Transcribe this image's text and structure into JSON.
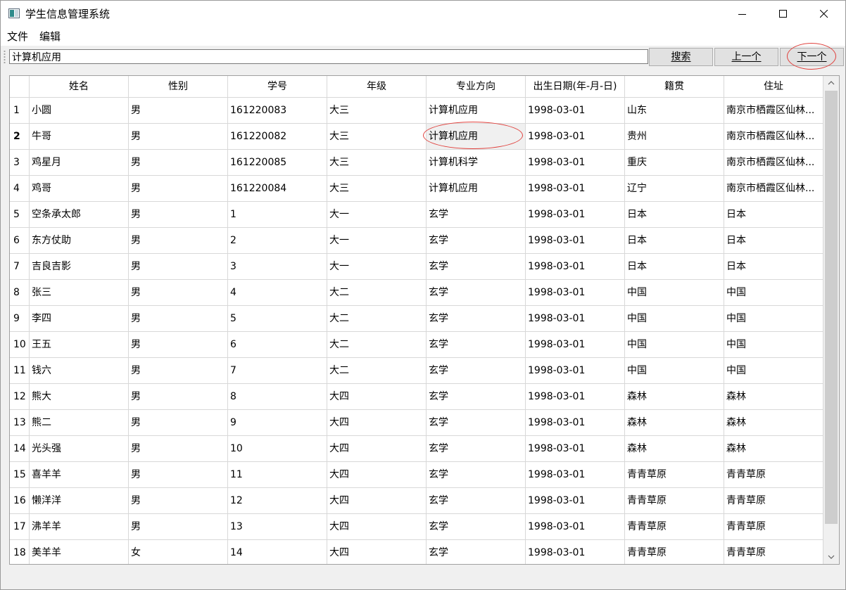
{
  "window": {
    "title": "学生信息管理系统"
  },
  "menu": {
    "file": "文件",
    "edit": "编辑"
  },
  "toolbar": {
    "search_value": "计算机应用",
    "search_label": "搜索",
    "prev_label": "上一个",
    "next_label": "下一个"
  },
  "table": {
    "headers": [
      "姓名",
      "性别",
      "学号",
      "年级",
      "专业方向",
      "出生日期(年-月-日)",
      "籍贯",
      "住址"
    ],
    "current_row": 2,
    "rows": [
      [
        "1",
        "小圆",
        "男",
        "161220083",
        "大三",
        "计算机应用",
        "1998-03-01",
        "山东",
        "南京市栖霞区仙林..."
      ],
      [
        "2",
        "牛哥",
        "男",
        "161220082",
        "大三",
        "计算机应用",
        "1998-03-01",
        "贵州",
        "南京市栖霞区仙林..."
      ],
      [
        "3",
        "鸡星月",
        "男",
        "161220085",
        "大三",
        "计算机科学",
        "1998-03-01",
        "重庆",
        "南京市栖霞区仙林..."
      ],
      [
        "4",
        "鸡哥",
        "男",
        "161220084",
        "大三",
        "计算机应用",
        "1998-03-01",
        "辽宁",
        "南京市栖霞区仙林..."
      ],
      [
        "5",
        "空条承太郎",
        "男",
        "1",
        "大一",
        "玄学",
        "1998-03-01",
        "日本",
        "日本"
      ],
      [
        "6",
        "东方仗助",
        "男",
        "2",
        "大一",
        "玄学",
        "1998-03-01",
        "日本",
        "日本"
      ],
      [
        "7",
        "吉良吉影",
        "男",
        "3",
        "大一",
        "玄学",
        "1998-03-01",
        "日本",
        "日本"
      ],
      [
        "8",
        "张三",
        "男",
        "4",
        "大二",
        "玄学",
        "1998-03-01",
        "中国",
        "中国"
      ],
      [
        "9",
        "李四",
        "男",
        "5",
        "大二",
        "玄学",
        "1998-03-01",
        "中国",
        "中国"
      ],
      [
        "10",
        "王五",
        "男",
        "6",
        "大二",
        "玄学",
        "1998-03-01",
        "中国",
        "中国"
      ],
      [
        "11",
        "钱六",
        "男",
        "7",
        "大二",
        "玄学",
        "1998-03-01",
        "中国",
        "中国"
      ],
      [
        "12",
        "熊大",
        "男",
        "8",
        "大四",
        "玄学",
        "1998-03-01",
        "森林",
        "森林"
      ],
      [
        "13",
        "熊二",
        "男",
        "9",
        "大四",
        "玄学",
        "1998-03-01",
        "森林",
        "森林"
      ],
      [
        "14",
        "光头强",
        "男",
        "10",
        "大四",
        "玄学",
        "1998-03-01",
        "森林",
        "森林"
      ],
      [
        "15",
        "喜羊羊",
        "男",
        "11",
        "大四",
        "玄学",
        "1998-03-01",
        "青青草原",
        "青青草原"
      ],
      [
        "16",
        "懒洋洋",
        "男",
        "12",
        "大四",
        "玄学",
        "1998-03-01",
        "青青草原",
        "青青草原"
      ],
      [
        "17",
        "沸羊羊",
        "男",
        "13",
        "大四",
        "玄学",
        "1998-03-01",
        "青青草原",
        "青青草原"
      ],
      [
        "18",
        "美羊羊",
        "女",
        "14",
        "大四",
        "玄学",
        "1998-03-01",
        "青青草原",
        "青青草原"
      ]
    ]
  },
  "colors": {
    "annotation": "#e0403c",
    "selected_cell": "#f0f0f0"
  }
}
